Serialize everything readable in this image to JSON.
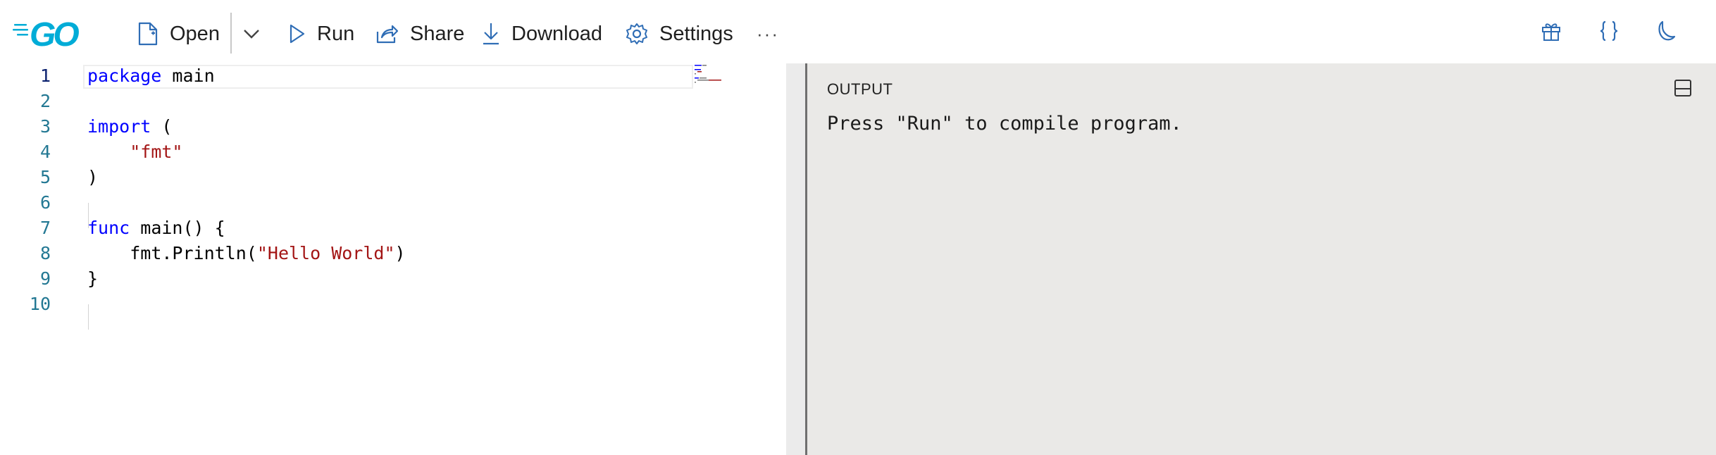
{
  "toolbar": {
    "logo_text": "GO",
    "open_label": "Open",
    "run_label": "Run",
    "share_label": "Share",
    "download_label": "Download",
    "settings_label": "Settings",
    "more_label": "···"
  },
  "right_icons": [
    "gift-icon",
    "braces-icon",
    "moon-icon"
  ],
  "editor": {
    "line_numbers": [
      "1",
      "2",
      "3",
      "4",
      "5",
      "6",
      "7",
      "8",
      "9",
      "10"
    ],
    "active_line": 1,
    "lines": [
      {
        "kw": "package",
        "rest": " main"
      },
      {
        "kw": "",
        "rest": ""
      },
      {
        "kw": "import",
        "rest": " ("
      },
      {
        "indent": "    ",
        "str": "\"fmt\""
      },
      {
        "kw": "",
        "rest": ")"
      },
      {
        "kw": "",
        "rest": ""
      },
      {
        "kw": "func",
        "rest": " main() {"
      },
      {
        "indent": "    ",
        "pre": "fmt.Println(",
        "str": "\"Hello World\"",
        "post": ")"
      },
      {
        "kw": "",
        "rest": "}"
      },
      {
        "kw": "",
        "rest": ""
      }
    ]
  },
  "output": {
    "title": "OUTPUT",
    "text": "Press \"Run\" to compile program."
  },
  "colors": {
    "accent": "#2f6db5",
    "keyword": "#0000ff",
    "string": "#a31515",
    "line_number": "#237893",
    "output_bg": "#eae9e7"
  }
}
